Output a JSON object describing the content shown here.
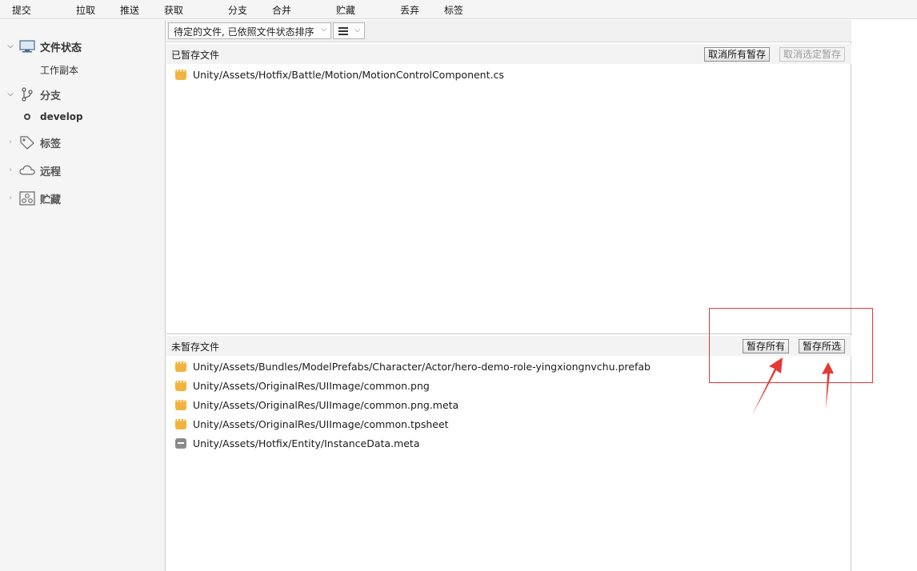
{
  "toolbar": {
    "items": [
      "提交",
      "拉取",
      "推送",
      "获取",
      "分支",
      "合并",
      "贮藏",
      "丢弃",
      "标签"
    ]
  },
  "sidebar": {
    "file_status": {
      "label": "文件状态",
      "icon": "monitor-icon",
      "children": [
        "工作副本"
      ]
    },
    "branches": {
      "label": "分支",
      "icon": "branch-icon",
      "children": [
        "develop"
      ]
    },
    "tags": {
      "label": "标签",
      "icon": "tag-icon"
    },
    "remotes": {
      "label": "远程",
      "icon": "cloud-icon"
    },
    "stashes": {
      "label": "贮藏",
      "icon": "stash-icon"
    }
  },
  "filter": {
    "sort_label": "待定的文件, 已依照文件状态排序",
    "view_icon": "list-view-icon"
  },
  "staged": {
    "title": "已暂存文件",
    "unstage_all_label": "取消所有暂存",
    "unstage_selected_label": "取消选定暂存",
    "files": [
      {
        "path": "Unity/Assets/Hotfix/Battle/Motion/MotionControlComponent.cs",
        "status": "modified"
      }
    ]
  },
  "unstaged": {
    "title": "未暂存文件",
    "stage_all_label": "暂存所有",
    "stage_selected_label": "暂存所选",
    "files": [
      {
        "path": "Unity/Assets/Bundles/ModelPrefabs/Character/Actor/hero-demo-role-yingxiongnvchu.prefab",
        "status": "modified"
      },
      {
        "path": "Unity/Assets/OriginalRes/UIImage/common.png",
        "status": "modified"
      },
      {
        "path": "Unity/Assets/OriginalRes/UIImage/common.png.meta",
        "status": "modified"
      },
      {
        "path": "Unity/Assets/OriginalRes/UIImage/common.tpsheet",
        "status": "modified"
      },
      {
        "path": "Unity/Assets/Hotfix/Entity/InstanceData.meta",
        "status": "removed"
      }
    ]
  },
  "colors": {
    "modified_badge": "#f2b33d",
    "removed_badge": "#8a8a8a",
    "annotation": "#e53935"
  }
}
